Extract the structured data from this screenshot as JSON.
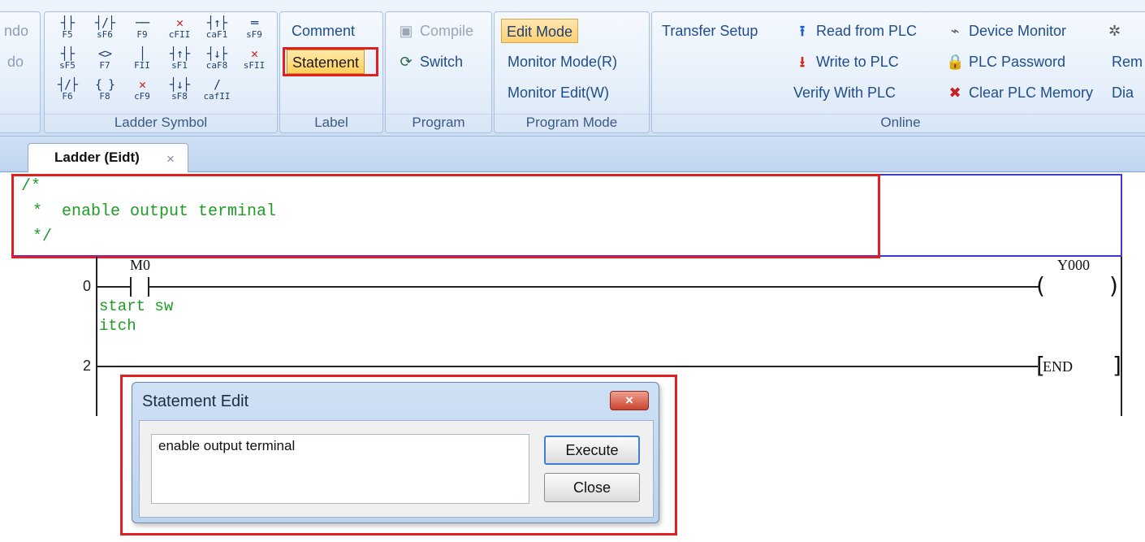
{
  "ribbon": {
    "cut_off_left": {
      "item1": "ndo",
      "item2": "do"
    },
    "ladder_symbols": {
      "label": "Ladder Symbol",
      "rows": [
        [
          {
            "glyph": "┤├",
            "key": "F5"
          },
          {
            "glyph": "┤/├",
            "key": "sF6"
          },
          {
            "glyph": "──",
            "key": "F9"
          },
          {
            "glyph": "✕",
            "key": "cFII",
            "red": true
          },
          {
            "glyph": "┤↑├",
            "key": "caF1"
          },
          {
            "glyph": "═",
            "key": "sF9"
          }
        ],
        [
          {
            "glyph": "┤├",
            "key": "sF5"
          },
          {
            "glyph": "<>",
            "key": "F7"
          },
          {
            "glyph": "│",
            "key": "FII"
          },
          {
            "glyph": "┤↑├",
            "key": "sF1"
          },
          {
            "glyph": "┤↓├",
            "key": "caF8"
          },
          {
            "glyph": "✕",
            "key": "sFII",
            "red": true
          }
        ],
        [
          {
            "glyph": "┤/├",
            "key": "F6"
          },
          {
            "glyph": "{ }",
            "key": "F8"
          },
          {
            "glyph": "✕",
            "key": "cF9",
            "red": true
          },
          {
            "glyph": "┤↓├",
            "key": "sF8"
          },
          {
            "glyph": "/",
            "key": "cafII"
          }
        ]
      ]
    },
    "label_group": {
      "label": "Label",
      "comment": "Comment",
      "statement": "Statement"
    },
    "program_group": {
      "label": "Program",
      "compile": "Compile",
      "switch": "Switch"
    },
    "program_mode": {
      "label": "Program Mode",
      "edit_mode": "Edit Mode",
      "monitor_mode": "Monitor Mode(R)",
      "monitor_edit": "Monitor Edit(W)"
    },
    "online": {
      "label": "Online",
      "transfer_setup": "Transfer Setup",
      "read_from_plc": "Read from PLC",
      "write_to_plc": "Write to PLC",
      "verify_with_plc": "Verify With PLC",
      "device_monitor": "Device Monitor",
      "plc_password": "PLC Password",
      "clear_plc_memory": "Clear PLC Memory",
      "cut_rem": "Rem",
      "cut_dia": "Dia"
    }
  },
  "tabs": [
    {
      "label": "Ladder (Eidt)",
      "close": "×"
    }
  ],
  "editor": {
    "statement_comment": [
      "/*",
      "*  enable output terminal",
      " */"
    ],
    "rungs": [
      {
        "step": "0",
        "contact": "M0",
        "contact_comment": [
          "start sw",
          "itch"
        ],
        "coil": "Y000"
      },
      {
        "step": "2",
        "instruction": "END"
      }
    ]
  },
  "dialog": {
    "title": "Statement Edit",
    "close_icon": "×",
    "input_value": "enable output terminal",
    "execute": "Execute",
    "close": "Close"
  },
  "colors": {
    "highlight": "#e02020",
    "comment_green": "#1f9b26",
    "ribbon_blue": "#1f4d8c"
  }
}
